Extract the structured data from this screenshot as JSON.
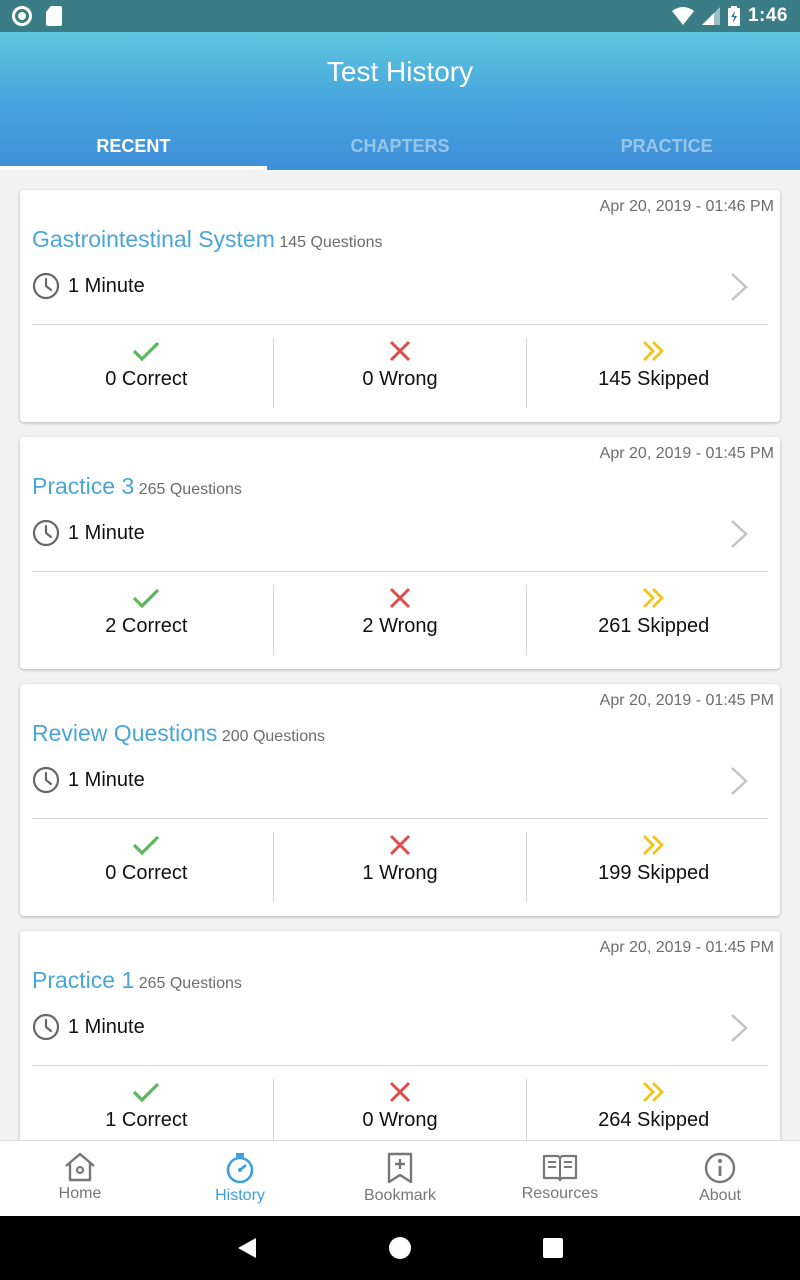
{
  "status_bar": {
    "time": "1:46"
  },
  "header": {
    "title": "Test History"
  },
  "tabs": [
    {
      "label": "RECENT",
      "active": true
    },
    {
      "label": "CHAPTERS",
      "active": false
    },
    {
      "label": "PRACTICE",
      "active": false
    }
  ],
  "cards": [
    {
      "date": "Apr 20, 2019 - 01:46 PM",
      "name": "Gastrointestinal System",
      "questions": "145 Questions",
      "time": "1 Minute",
      "correct": "0 Correct",
      "wrong": "0 Wrong",
      "skipped": "145 Skipped"
    },
    {
      "date": "Apr 20, 2019 - 01:45 PM",
      "name": "Practice 3",
      "questions": "265 Questions",
      "time": "1 Minute",
      "correct": "2 Correct",
      "wrong": "2 Wrong",
      "skipped": "261 Skipped"
    },
    {
      "date": "Apr 20, 2019 - 01:45 PM",
      "name": "Review Questions",
      "questions": "200 Questions",
      "time": "1 Minute",
      "correct": "0 Correct",
      "wrong": "1 Wrong",
      "skipped": "199 Skipped"
    },
    {
      "date": "Apr 20, 2019 - 01:45 PM",
      "name": "Practice 1",
      "questions": "265 Questions",
      "time": "1 Minute",
      "correct": "1 Correct",
      "wrong": "0 Wrong",
      "skipped": "264 Skipped"
    }
  ],
  "bottom_nav": [
    {
      "label": "Home",
      "icon": "home-icon"
    },
    {
      "label": "History",
      "icon": "stopwatch-icon",
      "active": true
    },
    {
      "label": "Bookmark",
      "icon": "bookmark-icon"
    },
    {
      "label": "Resources",
      "icon": "book-icon"
    },
    {
      "label": "About",
      "icon": "info-icon"
    }
  ],
  "colors": {
    "accent": "#4aa6d6",
    "correct": "#5cb85c",
    "wrong": "#e04b4b",
    "skipped": "#f0c419",
    "status_bar": "#3a7d86"
  }
}
